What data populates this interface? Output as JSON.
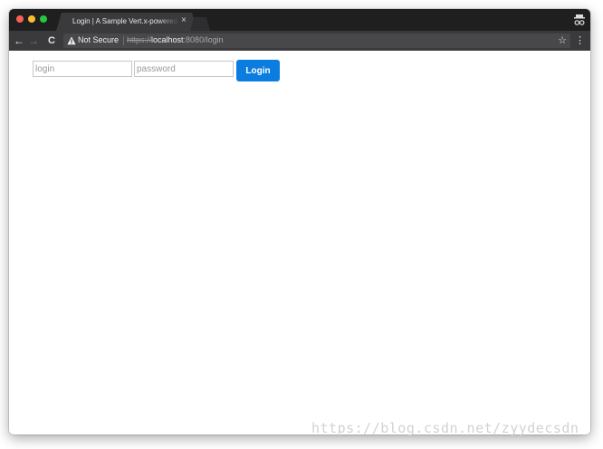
{
  "browser": {
    "tab": {
      "title": "Login | A Sample Vert.x-powered",
      "close": "×"
    },
    "toolbar": {
      "back": "←",
      "forward": "→",
      "reload": "C",
      "security_label": "Not Secure",
      "url": {
        "scheme": "https://",
        "host": "localhost",
        "rest": ":8080/login"
      },
      "bookmark_star": "☆",
      "menu": "⋮"
    }
  },
  "form": {
    "login_placeholder": "login",
    "password_placeholder": "password",
    "login_button": "Login"
  },
  "watermark": "https://blog.csdn.net/zyydecsdn",
  "colors": {
    "titlebar": "#1f1f20",
    "toolbar": "#3a3a3c",
    "button": "#0b7de0",
    "close": "#fe5f57",
    "minimize": "#febc2e",
    "maximize": "#28c840"
  }
}
